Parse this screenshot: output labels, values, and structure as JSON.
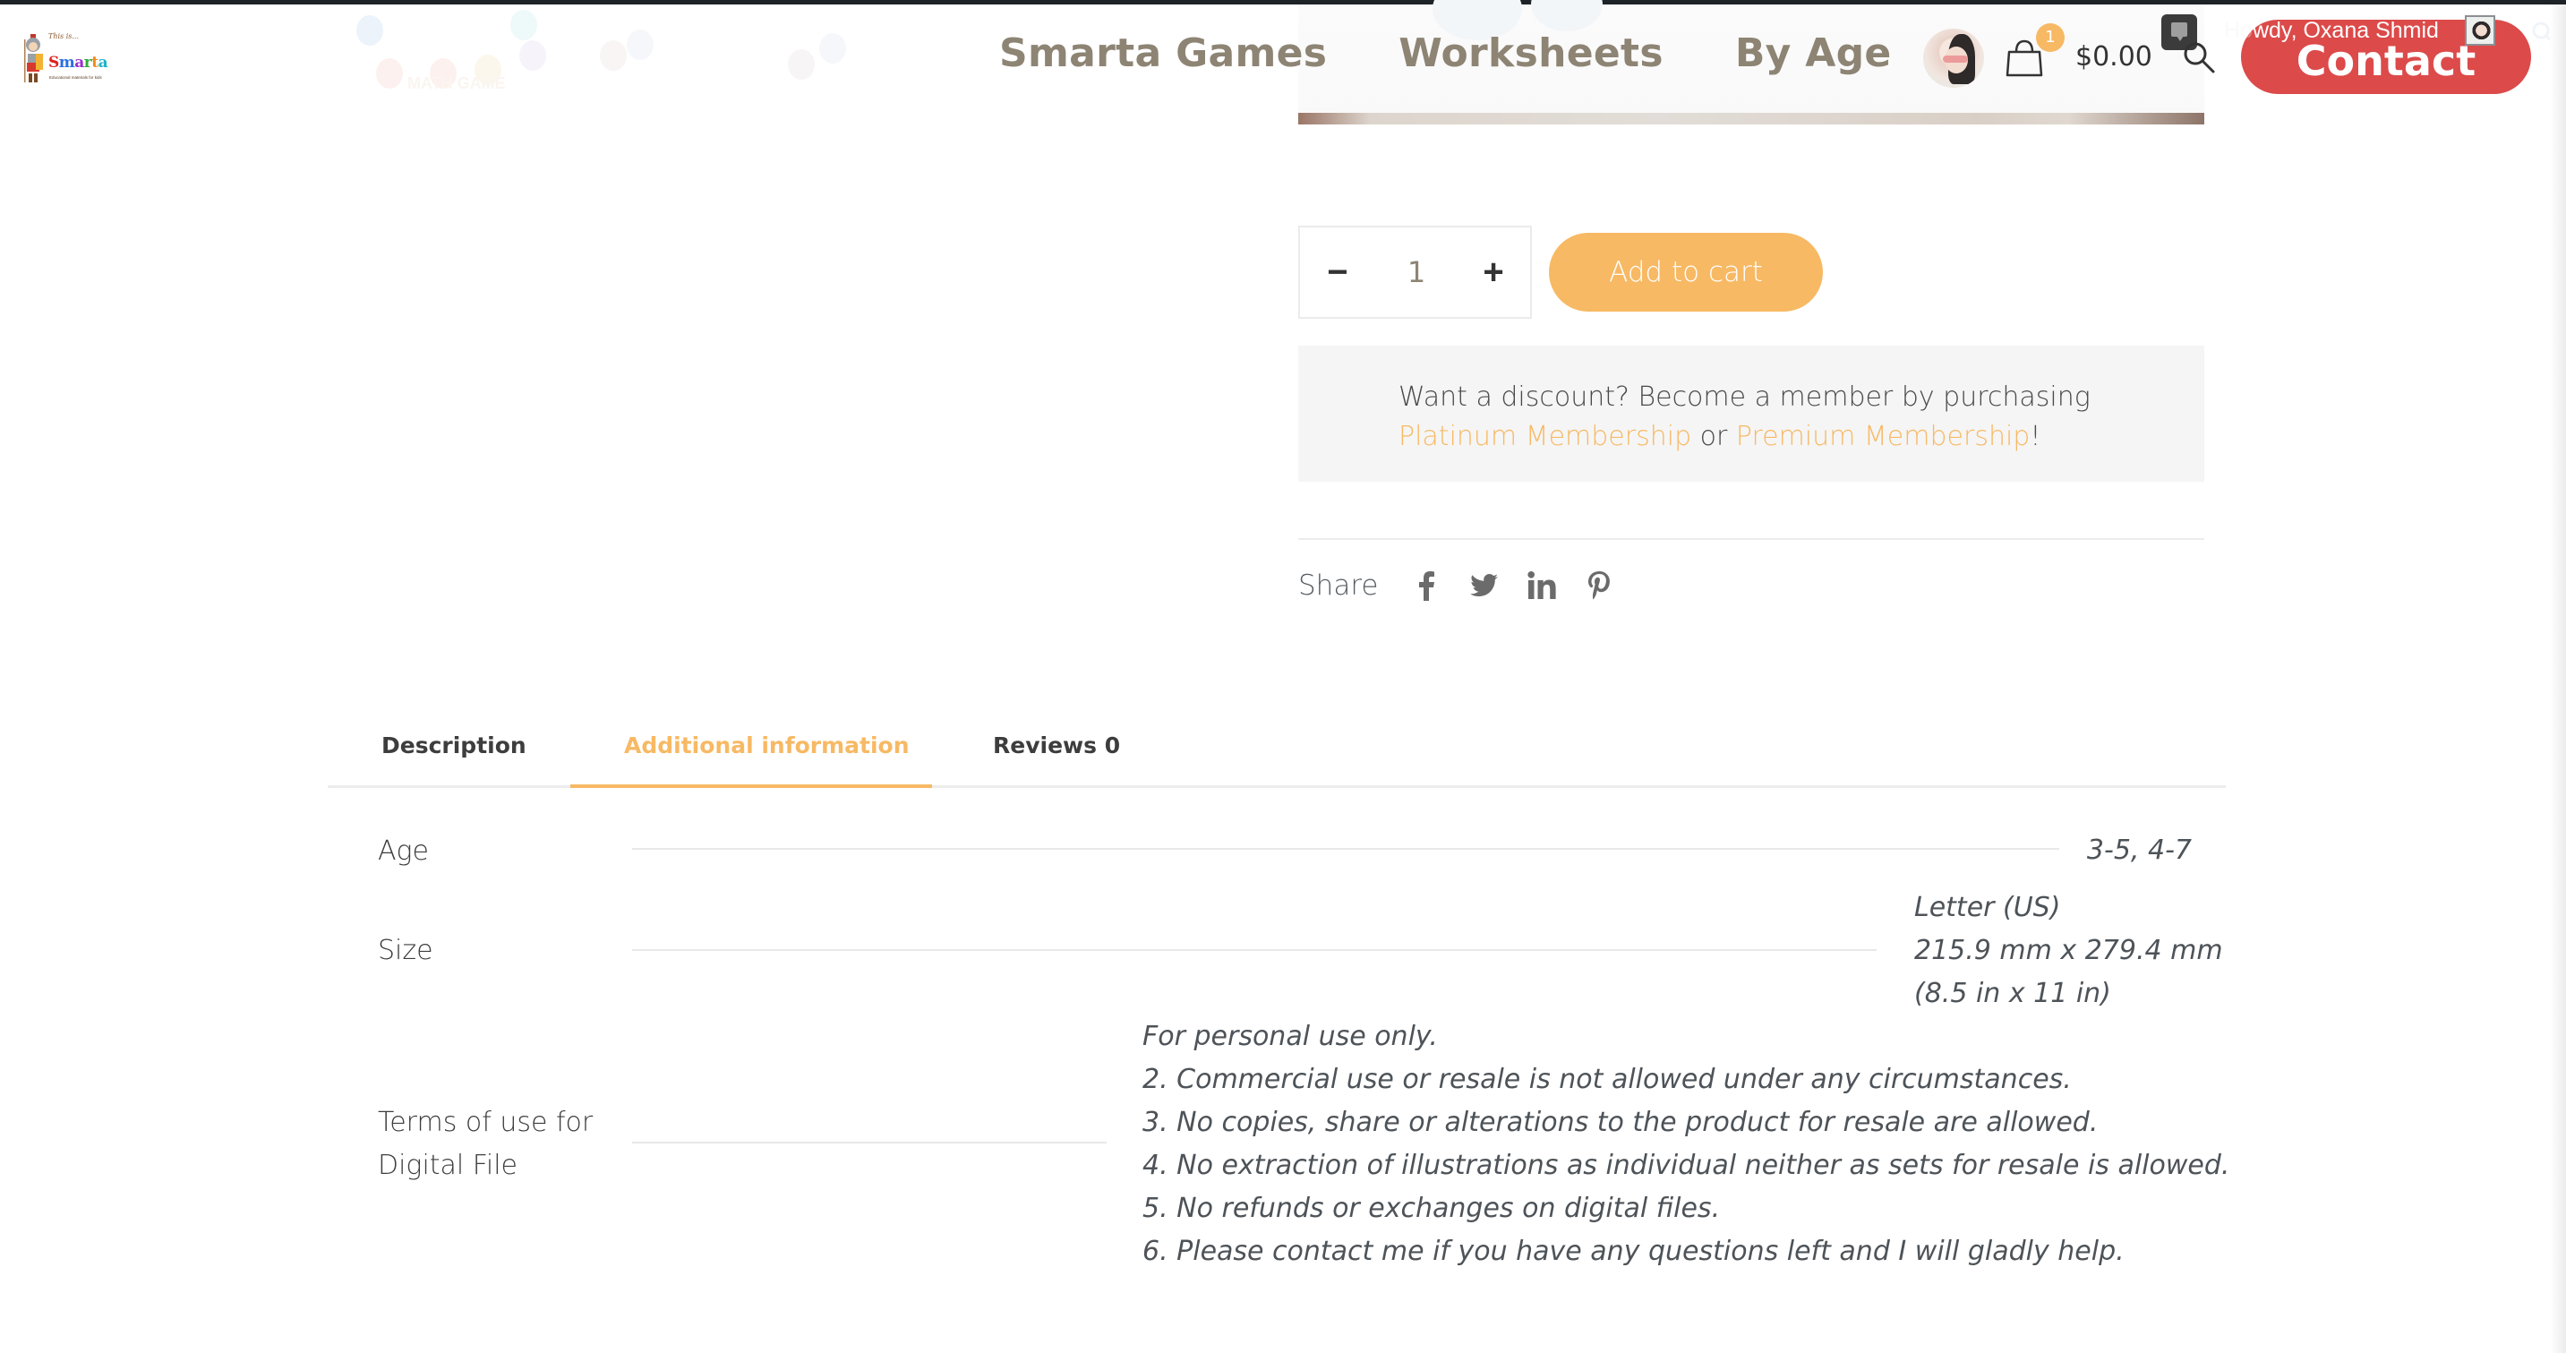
{
  "brand": {
    "logo_prefix": "This is...",
    "logo_word": "Smarta",
    "logo_tagline": "Educational materials for kids",
    "logo_letter_colors": [
      "#e02020",
      "#2b6fe0",
      "#9b2fd0",
      "#2fae3a",
      "#f08a1c",
      "#1fb4c8"
    ]
  },
  "nav": {
    "items": [
      {
        "label": "Smarta Games"
      },
      {
        "label": "Worksheets"
      },
      {
        "label": "By Age"
      }
    ]
  },
  "header": {
    "cart_count": "1",
    "cart_total": "$0.00",
    "contact_label": "Contact",
    "howdy_text": "Howdy, Oxana Shmid",
    "background_image_caption": "MATH GAME"
  },
  "product": {
    "quantity": "1",
    "minus_label": "−",
    "plus_label": "+",
    "add_to_cart_label": "Add to cart",
    "discount": {
      "text": "Want a discount? Become a member by purchasing",
      "link1": "Platinum Membership",
      "middle": " or ",
      "link2": "Premium Membership",
      "suffix": "!"
    },
    "share": {
      "label": "Share",
      "networks": [
        "facebook",
        "twitter",
        "linkedin",
        "pinterest"
      ]
    }
  },
  "tabs": {
    "items": [
      {
        "label": "Description",
        "active": false
      },
      {
        "label": "Additional information",
        "active": true
      },
      {
        "label": "Reviews 0",
        "active": false
      }
    ]
  },
  "attributes": {
    "rows": [
      {
        "label": "Age",
        "values": [
          "3-5, 4-7"
        ]
      },
      {
        "label": "Size",
        "values": [
          "Letter (US)",
          "215.9 mm x 279.4 mm",
          "(8.5 in x 11 in)"
        ]
      },
      {
        "label_lines": [
          "Terms of use for",
          "Digital File"
        ],
        "values": [
          "For personal use only.",
          "2. Commercial use or resale is not allowed under any circumstances.",
          "3. No copies, share or alterations to the product for resale are allowed.",
          "4. No extraction of illustrations as individual neither as sets for resale is allowed.",
          "5. No refunds or exchanges on digital files.",
          "6. Please contact me if you have any questions left and I will gladly help."
        ]
      }
    ]
  },
  "colors": {
    "accent": "#f7b964",
    "contact": "#dc4a4a",
    "nav_text": "#8d8474",
    "admin_bar": "#1d2327"
  }
}
